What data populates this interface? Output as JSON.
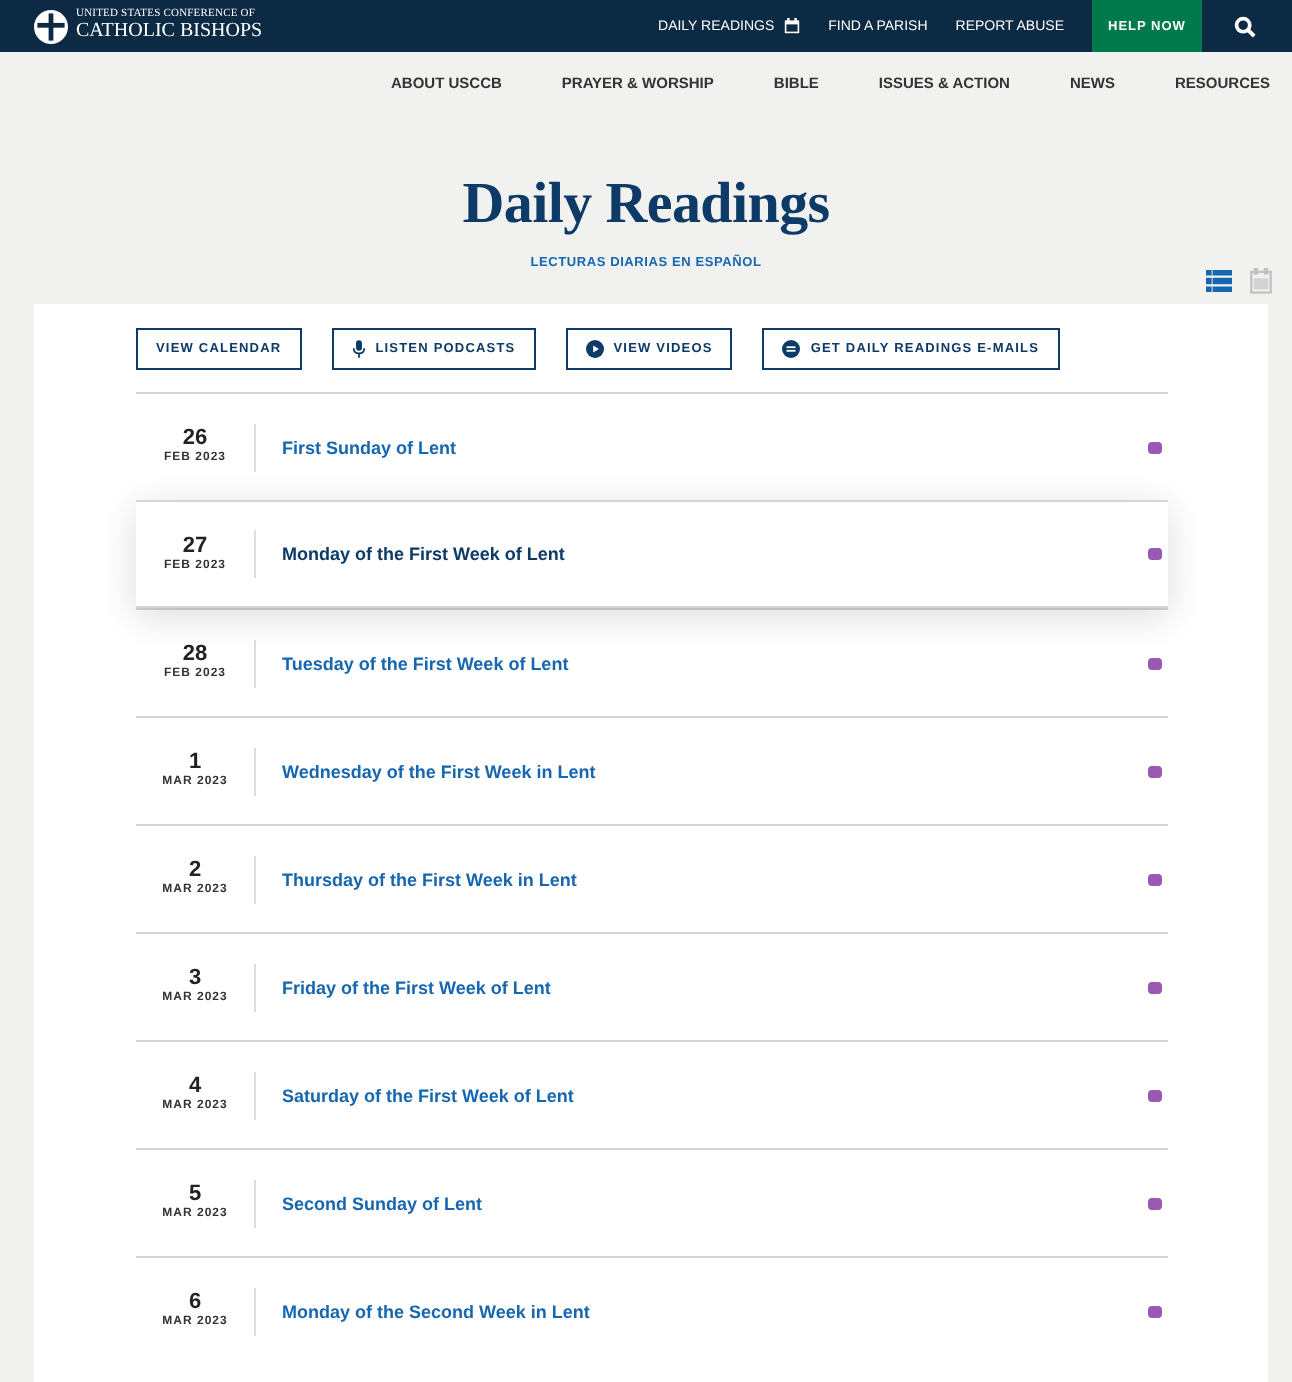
{
  "logo": {
    "line1": "UNITED STATES CONFERENCE OF",
    "line2": "CATHOLIC BISHOPS"
  },
  "top_links": [
    {
      "label": "DAILY READINGS",
      "kind": "calendar"
    },
    {
      "label": "FIND A PARISH",
      "kind": "plain"
    },
    {
      "label": "REPORT ABUSE",
      "kind": "plain"
    }
  ],
  "help_button": "HELP NOW",
  "main_nav": [
    "ABOUT USCCB",
    "PRAYER & WORSHIP",
    "BIBLE",
    "ISSUES & ACTION",
    "NEWS",
    "RESOURCES"
  ],
  "page_title": "Daily Readings",
  "spanish_link": "LECTURAS DIARIAS EN ESPAÑOL",
  "view_toggle": [
    {
      "kind": "list",
      "selected": true
    },
    {
      "kind": "calendar",
      "selected": false
    }
  ],
  "actions": [
    {
      "label": "VIEW CALENDAR",
      "kind": "plain"
    },
    {
      "label": "LISTEN PODCASTS",
      "kind": "mic"
    },
    {
      "label": "VIEW VIDEOS",
      "kind": "play"
    },
    {
      "label": "GET DAILY READINGS E-MAILS",
      "kind": "mail"
    }
  ],
  "readings": [
    {
      "day": "26",
      "month": "FEB 2023",
      "title": "First Sunday of Lent",
      "selected": false,
      "color": "#9b59b6"
    },
    {
      "day": "27",
      "month": "FEB 2023",
      "title": "Monday of the First Week of Lent",
      "selected": true,
      "color": "#9b59b6"
    },
    {
      "day": "28",
      "month": "FEB 2023",
      "title": "Tuesday of the First Week of Lent",
      "selected": false,
      "color": "#9b59b6"
    },
    {
      "day": "1",
      "month": "MAR 2023",
      "title": "Wednesday of the First Week in Lent",
      "selected": false,
      "color": "#9b59b6"
    },
    {
      "day": "2",
      "month": "MAR 2023",
      "title": "Thursday of the First Week in Lent",
      "selected": false,
      "color": "#9b59b6"
    },
    {
      "day": "3",
      "month": "MAR 2023",
      "title": "Friday of the First Week of Lent",
      "selected": false,
      "color": "#9b59b6"
    },
    {
      "day": "4",
      "month": "MAR 2023",
      "title": "Saturday of the First Week of Lent",
      "selected": false,
      "color": "#9b59b6"
    },
    {
      "day": "5",
      "month": "MAR 2023",
      "title": "Second Sunday of Lent",
      "selected": false,
      "color": "#9b59b6"
    },
    {
      "day": "6",
      "month": "MAR 2023",
      "title": "Monday of the Second Week in Lent",
      "selected": false,
      "color": "#9b59b6"
    }
  ]
}
